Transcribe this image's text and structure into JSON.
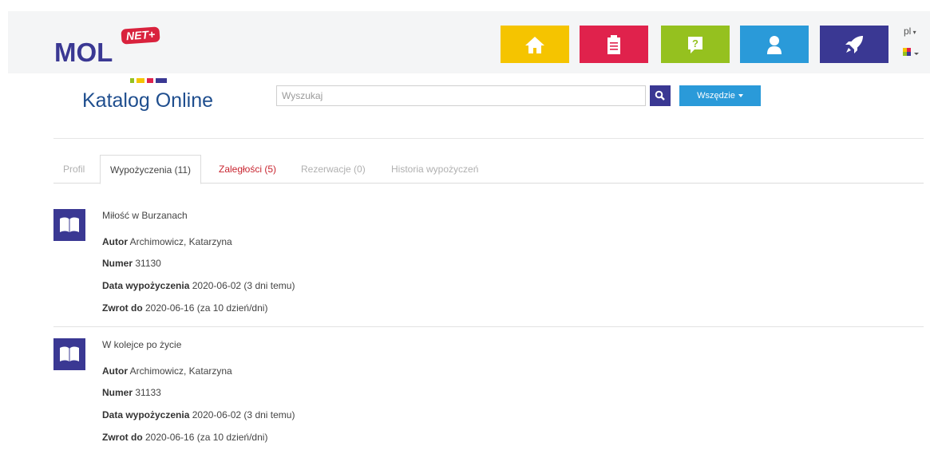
{
  "header": {
    "logo_text": "MOL",
    "logo_badge": "NET+",
    "nav_tiles": [
      {
        "icon": "home-icon",
        "color": "#f5c400"
      },
      {
        "icon": "clipboard-icon",
        "color": "#e0224c"
      },
      {
        "icon": "question-icon",
        "color": "#95c11f"
      },
      {
        "icon": "user-icon",
        "color": "#2a9ad9"
      },
      {
        "icon": "rocket-icon",
        "color": "#3a3893"
      }
    ],
    "language": "pl"
  },
  "catalog": {
    "title": "Katalog Online",
    "search_placeholder": "Wyszukaj",
    "scope_label": "Wszędzie"
  },
  "tabs": [
    {
      "label": "Profil",
      "state": "muted"
    },
    {
      "label": "Wypożyczenia (11)",
      "state": "active"
    },
    {
      "label": "Zaległości (5)",
      "state": "alert"
    },
    {
      "label": "Rezerwacje (0)",
      "state": "muted"
    },
    {
      "label": "Historia wypożyczeń",
      "state": "muted"
    }
  ],
  "labels": {
    "author": "Autor",
    "number": "Numer",
    "loan_date": "Data wypożyczenia",
    "return_by": "Zwrot do"
  },
  "loans": [
    {
      "title": "Miłość w Burzanach",
      "author": "Archimowicz, Katarzyna",
      "number": "31130",
      "loan_date": "2020-06-02 (3 dni temu)",
      "return_by": "2020-06-16 (za 10 dzień/dni)"
    },
    {
      "title": "W kolejce po życie",
      "author": "Archimowicz, Katarzyna",
      "number": "31133",
      "loan_date": "2020-06-02 (3 dni temu)",
      "return_by": "2020-06-16 (za 10 dzień/dni)"
    }
  ],
  "colors": {
    "brand_purple": "#3a3893",
    "brand_red": "#d9223d",
    "accent_blue": "#2a9ad9",
    "title_blue": "#1f4e8e",
    "alert_red": "#c8242f"
  }
}
